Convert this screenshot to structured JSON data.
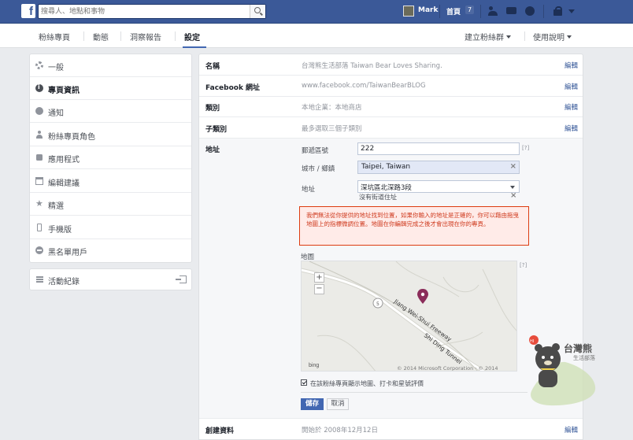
{
  "topbar": {
    "logo": "f",
    "search_placeholder": "搜尋人、地點和事物",
    "user_name": "Mark",
    "home_label": "首頁",
    "home_count": "7",
    "brand_color": "#3b5998"
  },
  "subnav": {
    "tabs": [
      "粉絲專頁",
      "動態",
      "洞察報告",
      "設定"
    ],
    "active_tab": "設定",
    "right_items": [
      "建立粉絲群",
      "使用說明"
    ]
  },
  "sidebar": {
    "items": [
      {
        "label": "一般",
        "icon": "gear-icon"
      },
      {
        "label": "專頁資訊",
        "icon": "info-icon",
        "active": true
      },
      {
        "label": "通知",
        "icon": "globe-icon"
      },
      {
        "label": "粉絲專頁角色",
        "icon": "person-icon"
      },
      {
        "label": "應用程式",
        "icon": "cube-icon"
      },
      {
        "label": "編輯建議",
        "icon": "calendar-icon"
      },
      {
        "label": "精選",
        "icon": "star-icon"
      },
      {
        "label": "手機版",
        "icon": "mobile-icon"
      },
      {
        "label": "黑名單用戶",
        "icon": "ban-icon"
      }
    ],
    "activity_log": "活動紀錄"
  },
  "info_rows": [
    {
      "label": "名稱",
      "value": "台灣熊生活部落 Taiwan Bear Loves Sharing.",
      "edit": "編輯"
    },
    {
      "label": "Facebook 網址",
      "value": "www.facebook.com/TaiwanBearBLOG",
      "edit": "編輯"
    },
    {
      "label": "類別",
      "value": "本地企業：本地商店",
      "edit": "編輯"
    },
    {
      "label": "子類別",
      "value": "最多選取三個子類別",
      "edit": "編輯"
    }
  ],
  "address": {
    "label": "地址",
    "zip_label": "郵遞區號",
    "zip_value": "222",
    "city_label": "城市 / 鄉鎮",
    "city_value": "Taipei, Taiwan",
    "street_label": "地址",
    "street_value": "深坑區北深路3段",
    "street_hint": "沒有街道住址",
    "help": "[?]",
    "warning": "我們無法從你提供的地址找到位置，如果你輸入的地址是正確的，你可以藉由拖曳地圖上的指標微調位置。地圖在你編輯完成之後才會出現在你的專頁。",
    "map_label": "地圖",
    "map_road_1": "Jiang Wei-Shui Freeway",
    "map_road_2": "Shi Ding Tunnel",
    "map_route_number": "5",
    "map_provider": "bing",
    "map_copyright": "© 2014 Microsoft Corporation · © 2014",
    "show_map_label": "在該粉絲專頁顯示地圖、打卡和星號評價",
    "show_map_checked": true,
    "save_label": "儲存",
    "cancel_label": "取消"
  },
  "created_row": {
    "label": "創建資料",
    "value": "開始於 2008年12月12日",
    "edit": "編輯"
  },
  "watermark": {
    "text_main": "台灣熊",
    "text_sub": "生活部落"
  }
}
